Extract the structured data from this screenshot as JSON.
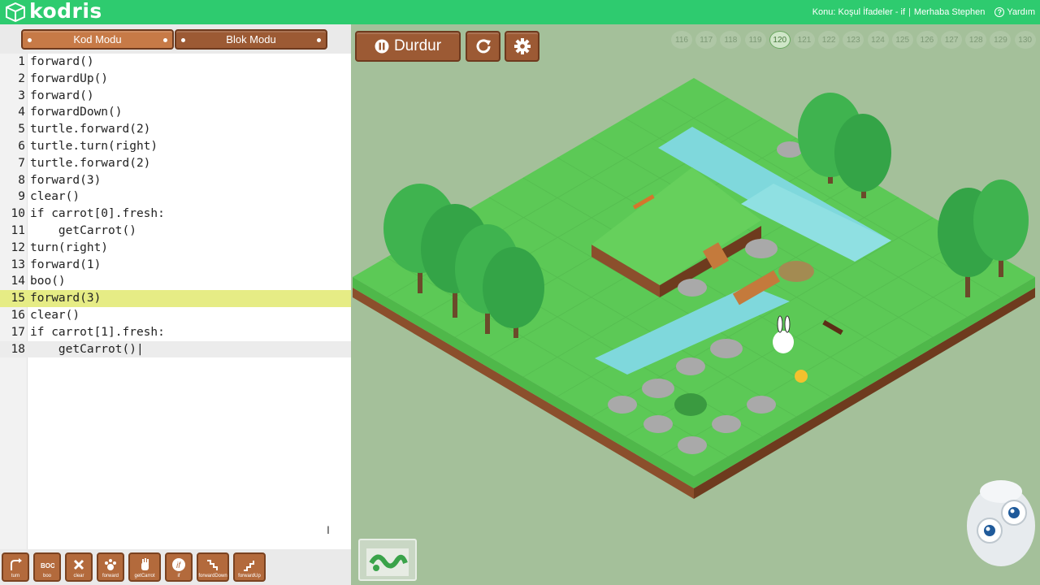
{
  "header": {
    "logo_text": "kodris",
    "topic": "Konu: Koşul İfadeler - if",
    "separator": "|",
    "greeting": "Merhaba Stephen",
    "help_label": "Yardım"
  },
  "tabs": {
    "code_mode": "Kod Modu",
    "block_mode": "Blok Modu",
    "active": "Kod Modu"
  },
  "editor": {
    "highlight_line": 15,
    "current_line": 18,
    "lines": [
      {
        "n": "1",
        "text": "forward()"
      },
      {
        "n": "2",
        "text": "forwardUp()"
      },
      {
        "n": "3",
        "text": "forward()"
      },
      {
        "n": "4",
        "text": "forwardDown()"
      },
      {
        "n": "5",
        "text": "turtle.forward(2)"
      },
      {
        "n": "6",
        "text": "turtle.turn(right)"
      },
      {
        "n": "7",
        "text": "turtle.forward(2)"
      },
      {
        "n": "8",
        "text": "forward(3)"
      },
      {
        "n": "9",
        "text": "clear()"
      },
      {
        "n": "10",
        "text": "if carrot[0].fresh:"
      },
      {
        "n": "11",
        "text": "    getCarrot()"
      },
      {
        "n": "12",
        "text": "turn(right)"
      },
      {
        "n": "13",
        "text": "forward(1)"
      },
      {
        "n": "14",
        "text": "boo()"
      },
      {
        "n": "15",
        "text": "forward(3)"
      },
      {
        "n": "16",
        "text": "clear()"
      },
      {
        "n": "17",
        "text": "if carrot[1].fresh:"
      },
      {
        "n": "18",
        "text": "    getCarrot()|"
      }
    ]
  },
  "toolbox": [
    {
      "label": "turn",
      "icon": "turn-icon"
    },
    {
      "label": "boo",
      "icon": "boo-icon"
    },
    {
      "label": "clear",
      "icon": "clear-icon"
    },
    {
      "label": "forward",
      "icon": "paw-icon"
    },
    {
      "label": "getCarrot",
      "icon": "hand-icon"
    },
    {
      "label": "if",
      "icon": "if-icon"
    },
    {
      "label": "forwardDown",
      "icon": "stairs-down-icon"
    },
    {
      "label": "forwardUp",
      "icon": "stairs-up-icon"
    }
  ],
  "controls": {
    "stop_label": "Durdur",
    "stop_icon": "pause-icon",
    "reset_icon": "restart-icon",
    "settings_icon": "gear-icon"
  },
  "levels": {
    "items": [
      "116",
      "117",
      "118",
      "119",
      "120",
      "121",
      "122",
      "123",
      "124",
      "125",
      "126",
      "127",
      "128",
      "129",
      "130"
    ],
    "current": "120"
  },
  "colors": {
    "topbar": "#2ecb6f",
    "wood": "#9c5a34",
    "wood_active": "#c77a47",
    "highlight": "#e6ec85",
    "grass": "#5cc956",
    "water": "#7fd8dc",
    "background": "#a4c09a"
  }
}
